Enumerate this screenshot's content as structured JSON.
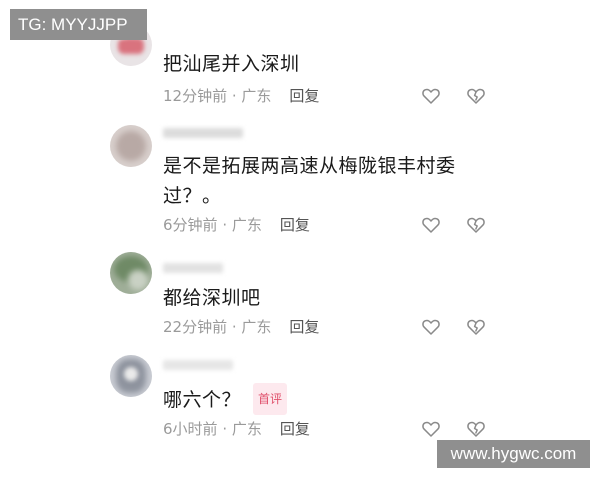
{
  "watermark_top": "TG: MYYJJPP",
  "watermark_bottom": "www.hygwc.com",
  "comments": [
    {
      "text": "把汕尾并入深圳",
      "time": "12分钟前",
      "location": "广东",
      "reply_label": "回复"
    },
    {
      "text": "是不是拓展两高速从梅陇银丰村委过？。",
      "time": "6分钟前",
      "location": "广东",
      "reply_label": "回复"
    },
    {
      "text": "都给深圳吧",
      "time": "22分钟前",
      "location": "广东",
      "reply_label": "回复"
    },
    {
      "text": "哪六个？",
      "badge": "首评",
      "time": "6小时前",
      "location": "广东",
      "reply_label": "回复"
    }
  ],
  "separator": " · ",
  "colors": {
    "meta": "#9a9a9a",
    "badge": "#e0506b",
    "badge_bg": "#fde9ee"
  },
  "icons": {
    "like": "heart-icon",
    "dislike": "broken-heart-icon"
  }
}
